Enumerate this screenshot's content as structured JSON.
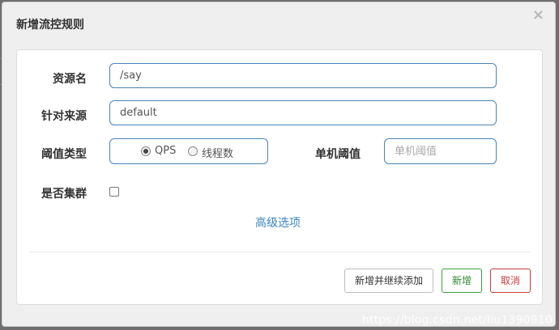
{
  "dialog": {
    "title": "新增流控规则",
    "close_glyph": "×"
  },
  "form": {
    "resource_label": "资源名",
    "resource_value": "/say",
    "source_label": "针对来源",
    "source_value": "default",
    "threshold_type_label": "阈值类型",
    "threshold_type_options": [
      {
        "label": "QPS",
        "checked": true
      },
      {
        "label": "线程数",
        "checked": false
      }
    ],
    "single_threshold_label": "单机阈值",
    "single_threshold_placeholder": "单机阈值",
    "cluster_label": "是否集群",
    "cluster_checked": false,
    "advanced_link": "高级选项"
  },
  "buttons": {
    "add_continue": "新增并继续添加",
    "add": "新增",
    "cancel": "取消"
  },
  "watermark": "https://blog.csdn.net/liu1390910",
  "colors": {
    "accent_border": "#4a83b5",
    "link": "#3b84c4",
    "success": "#2e8b2e",
    "danger": "#cc3a3a"
  },
  "icons": {
    "close": "close-icon"
  }
}
